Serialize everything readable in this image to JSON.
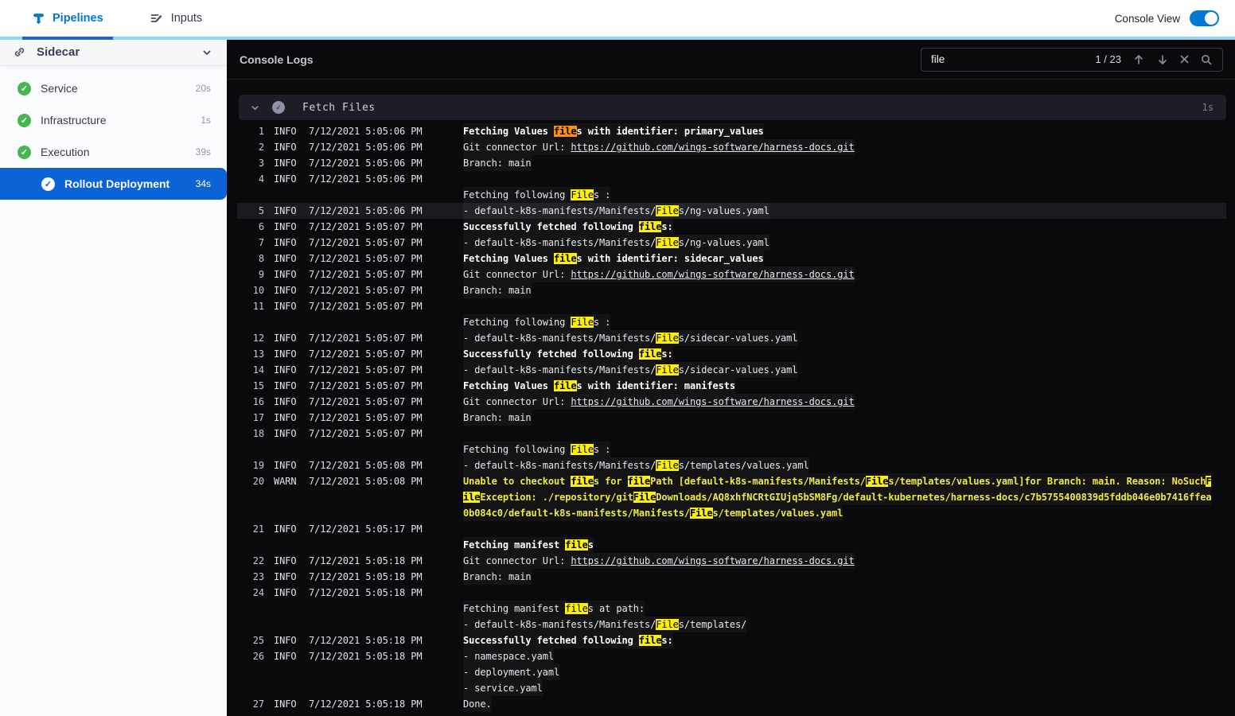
{
  "topnav": {
    "pipelines_label": "Pipelines",
    "inputs_label": "Inputs",
    "console_view_label": "Console View",
    "console_view_on": true
  },
  "sidebar": {
    "title": "Sidecar",
    "items": [
      {
        "label": "Service",
        "duration": "20s",
        "selected": false,
        "indent": false
      },
      {
        "label": "Infrastructure",
        "duration": "1s",
        "selected": false,
        "indent": false
      },
      {
        "label": "Execution",
        "duration": "39s",
        "selected": false,
        "indent": false
      },
      {
        "label": "Rollout Deployment",
        "duration": "34s",
        "selected": true,
        "indent": true
      }
    ]
  },
  "console": {
    "title": "Console Logs",
    "search": {
      "value": "file",
      "counter": "1 / 23"
    },
    "section": {
      "title": "Fetch Files",
      "duration": "1s"
    },
    "colors": {
      "accent_blue": "#0278d5",
      "selected_row_blue": "#0b63d6",
      "success_green": "#44b74e",
      "match_highlight": "#fdf100",
      "current_match_highlight": "#ff9100",
      "warn_text": "#efe93f",
      "light_blue_strip": "#8ed8f3"
    },
    "entries": [
      {
        "n": 1,
        "level": "INFO",
        "time": "7/12/2021 5:05:06 PM",
        "lines": [
          {
            "bold": true,
            "segs": [
              {
                "t": "Fetching Values "
              },
              {
                "t": "file",
                "m": "current"
              },
              {
                "t": "s with identifier: primary_values"
              }
            ]
          }
        ]
      },
      {
        "n": 2,
        "level": "INFO",
        "time": "7/12/2021 5:05:06 PM",
        "lines": [
          {
            "segs": [
              {
                "t": "Git connector Url: "
              },
              {
                "t": "https://github.com/wings-software/harness-docs.git",
                "link": true
              }
            ]
          }
        ]
      },
      {
        "n": 3,
        "level": "INFO",
        "time": "7/12/2021 5:05:06 PM",
        "lines": [
          {
            "segs": [
              {
                "t": "Branch: main"
              }
            ]
          }
        ]
      },
      {
        "n": 4,
        "level": "INFO",
        "time": "7/12/2021 5:05:06 PM",
        "lines": [
          {
            "segs": []
          },
          {
            "segs": [
              {
                "t": "Fetching following "
              },
              {
                "t": "File",
                "m": "match"
              },
              {
                "t": "s :"
              }
            ]
          }
        ]
      },
      {
        "n": 5,
        "level": "INFO",
        "time": "7/12/2021 5:05:06 PM",
        "selected": true,
        "lines": [
          {
            "segs": [
              {
                "t": "- default-k8s-manifests/Manifests/"
              },
              {
                "t": "File",
                "m": "match"
              },
              {
                "t": "s/ng-values.yaml"
              }
            ]
          }
        ]
      },
      {
        "n": 6,
        "level": "INFO",
        "time": "7/12/2021 5:05:07 PM",
        "lines": [
          {
            "bold": true,
            "segs": [
              {
                "t": "Successfully fetched following "
              },
              {
                "t": "file",
                "m": "match"
              },
              {
                "t": "s:"
              }
            ]
          }
        ]
      },
      {
        "n": 7,
        "level": "INFO",
        "time": "7/12/2021 5:05:07 PM",
        "lines": [
          {
            "segs": [
              {
                "t": "- default-k8s-manifests/Manifests/"
              },
              {
                "t": "File",
                "m": "match"
              },
              {
                "t": "s/ng-values.yaml"
              }
            ]
          }
        ]
      },
      {
        "n": 8,
        "level": "INFO",
        "time": "7/12/2021 5:05:07 PM",
        "lines": [
          {
            "bold": true,
            "segs": [
              {
                "t": "Fetching Values "
              },
              {
                "t": "file",
                "m": "match"
              },
              {
                "t": "s with identifier: sidecar_values"
              }
            ]
          }
        ]
      },
      {
        "n": 9,
        "level": "INFO",
        "time": "7/12/2021 5:05:07 PM",
        "lines": [
          {
            "segs": [
              {
                "t": "Git connector Url: "
              },
              {
                "t": "https://github.com/wings-software/harness-docs.git",
                "link": true
              }
            ]
          }
        ]
      },
      {
        "n": 10,
        "level": "INFO",
        "time": "7/12/2021 5:05:07 PM",
        "lines": [
          {
            "segs": [
              {
                "t": "Branch: main"
              }
            ]
          }
        ]
      },
      {
        "n": 11,
        "level": "INFO",
        "time": "7/12/2021 5:05:07 PM",
        "lines": [
          {
            "segs": []
          },
          {
            "segs": [
              {
                "t": "Fetching following "
              },
              {
                "t": "File",
                "m": "match"
              },
              {
                "t": "s :"
              }
            ]
          }
        ]
      },
      {
        "n": 12,
        "level": "INFO",
        "time": "7/12/2021 5:05:07 PM",
        "lines": [
          {
            "segs": [
              {
                "t": "- default-k8s-manifests/Manifests/"
              },
              {
                "t": "File",
                "m": "match"
              },
              {
                "t": "s/sidecar-values.yaml"
              }
            ]
          }
        ]
      },
      {
        "n": 13,
        "level": "INFO",
        "time": "7/12/2021 5:05:07 PM",
        "lines": [
          {
            "bold": true,
            "segs": [
              {
                "t": "Successfully fetched following "
              },
              {
                "t": "file",
                "m": "match"
              },
              {
                "t": "s:"
              }
            ]
          }
        ]
      },
      {
        "n": 14,
        "level": "INFO",
        "time": "7/12/2021 5:05:07 PM",
        "lines": [
          {
            "segs": [
              {
                "t": "- default-k8s-manifests/Manifests/"
              },
              {
                "t": "File",
                "m": "match"
              },
              {
                "t": "s/sidecar-values.yaml"
              }
            ]
          }
        ]
      },
      {
        "n": 15,
        "level": "INFO",
        "time": "7/12/2021 5:05:07 PM",
        "lines": [
          {
            "bold": true,
            "segs": [
              {
                "t": "Fetching Values "
              },
              {
                "t": "file",
                "m": "match"
              },
              {
                "t": "s with identifier: manifests"
              }
            ]
          }
        ]
      },
      {
        "n": 16,
        "level": "INFO",
        "time": "7/12/2021 5:05:07 PM",
        "lines": [
          {
            "segs": [
              {
                "t": "Git connector Url: "
              },
              {
                "t": "https://github.com/wings-software/harness-docs.git",
                "link": true
              }
            ]
          }
        ]
      },
      {
        "n": 17,
        "level": "INFO",
        "time": "7/12/2021 5:05:07 PM",
        "lines": [
          {
            "segs": [
              {
                "t": "Branch: main"
              }
            ]
          }
        ]
      },
      {
        "n": 18,
        "level": "INFO",
        "time": "7/12/2021 5:05:07 PM",
        "lines": [
          {
            "segs": []
          },
          {
            "segs": [
              {
                "t": "Fetching following "
              },
              {
                "t": "File",
                "m": "match"
              },
              {
                "t": "s :"
              }
            ]
          }
        ]
      },
      {
        "n": 19,
        "level": "INFO",
        "time": "7/12/2021 5:05:08 PM",
        "lines": [
          {
            "segs": [
              {
                "t": "- default-k8s-manifests/Manifests/"
              },
              {
                "t": "File",
                "m": "match"
              },
              {
                "t": "s/templates/values.yaml"
              }
            ]
          }
        ]
      },
      {
        "n": 20,
        "level": "WARN",
        "time": "7/12/2021 5:05:08 PM",
        "lines": [
          {
            "warn": true,
            "segs": [
              {
                "t": "Unable to checkout "
              },
              {
                "t": "file",
                "m": "match"
              },
              {
                "t": "s for "
              },
              {
                "t": "file",
                "m": "match"
              },
              {
                "t": "Path [default-k8s-manifests/Manifests/"
              },
              {
                "t": "File",
                "m": "match"
              },
              {
                "t": "s/templates/values.yaml]for Branch: main. Reason: NoSuch"
              },
              {
                "t": "F",
                "m": "match"
              }
            ]
          },
          {
            "warn": true,
            "segs": [
              {
                "t": "ile",
                "m": "match"
              },
              {
                "t": "Exception: ./repository/git"
              },
              {
                "t": "File",
                "m": "match"
              },
              {
                "t": "Downloads/AQ8xhfNCRtGIUjq5bSM8Fg/default-kubernetes/harness-docs/c7b5755400839d5fddb046e0b7416ffea"
              }
            ]
          },
          {
            "warn": true,
            "segs": [
              {
                "t": "0b084c0/default-k8s-manifests/Manifests/"
              },
              {
                "t": "File",
                "m": "match"
              },
              {
                "t": "s/templates/values.yaml"
              }
            ]
          }
        ]
      },
      {
        "n": 21,
        "level": "INFO",
        "time": "7/12/2021 5:05:17 PM",
        "lines": [
          {
            "segs": []
          },
          {
            "bold": true,
            "segs": [
              {
                "t": "Fetching manifest "
              },
              {
                "t": "file",
                "m": "match"
              },
              {
                "t": "s"
              }
            ]
          }
        ]
      },
      {
        "n": 22,
        "level": "INFO",
        "time": "7/12/2021 5:05:18 PM",
        "lines": [
          {
            "segs": [
              {
                "t": "Git connector Url: "
              },
              {
                "t": "https://github.com/wings-software/harness-docs.git",
                "link": true
              }
            ]
          }
        ]
      },
      {
        "n": 23,
        "level": "INFO",
        "time": "7/12/2021 5:05:18 PM",
        "lines": [
          {
            "segs": [
              {
                "t": "Branch: main"
              }
            ]
          }
        ]
      },
      {
        "n": 24,
        "level": "INFO",
        "time": "7/12/2021 5:05:18 PM",
        "lines": [
          {
            "segs": []
          },
          {
            "segs": [
              {
                "t": "Fetching manifest "
              },
              {
                "t": "file",
                "m": "match"
              },
              {
                "t": "s at path:"
              }
            ]
          },
          {
            "segs": [
              {
                "t": "- default-k8s-manifests/Manifests/"
              },
              {
                "t": "File",
                "m": "match"
              },
              {
                "t": "s/templates/"
              }
            ]
          }
        ]
      },
      {
        "n": 25,
        "level": "INFO",
        "time": "7/12/2021 5:05:18 PM",
        "lines": [
          {
            "bold": true,
            "segs": [
              {
                "t": "Successfully fetched following "
              },
              {
                "t": "file",
                "m": "match"
              },
              {
                "t": "s:"
              }
            ]
          }
        ]
      },
      {
        "n": 26,
        "level": "INFO",
        "time": "7/12/2021 5:05:18 PM",
        "lines": [
          {
            "segs": [
              {
                "t": "- namespace.yaml"
              }
            ]
          },
          {
            "segs": [
              {
                "t": "- deployment.yaml"
              }
            ]
          },
          {
            "segs": [
              {
                "t": "- service.yaml"
              }
            ]
          }
        ]
      },
      {
        "n": 27,
        "level": "INFO",
        "time": "7/12/2021 5:05:18 PM",
        "lines": [
          {
            "segs": [
              {
                "t": "Done."
              }
            ]
          }
        ]
      }
    ]
  }
}
